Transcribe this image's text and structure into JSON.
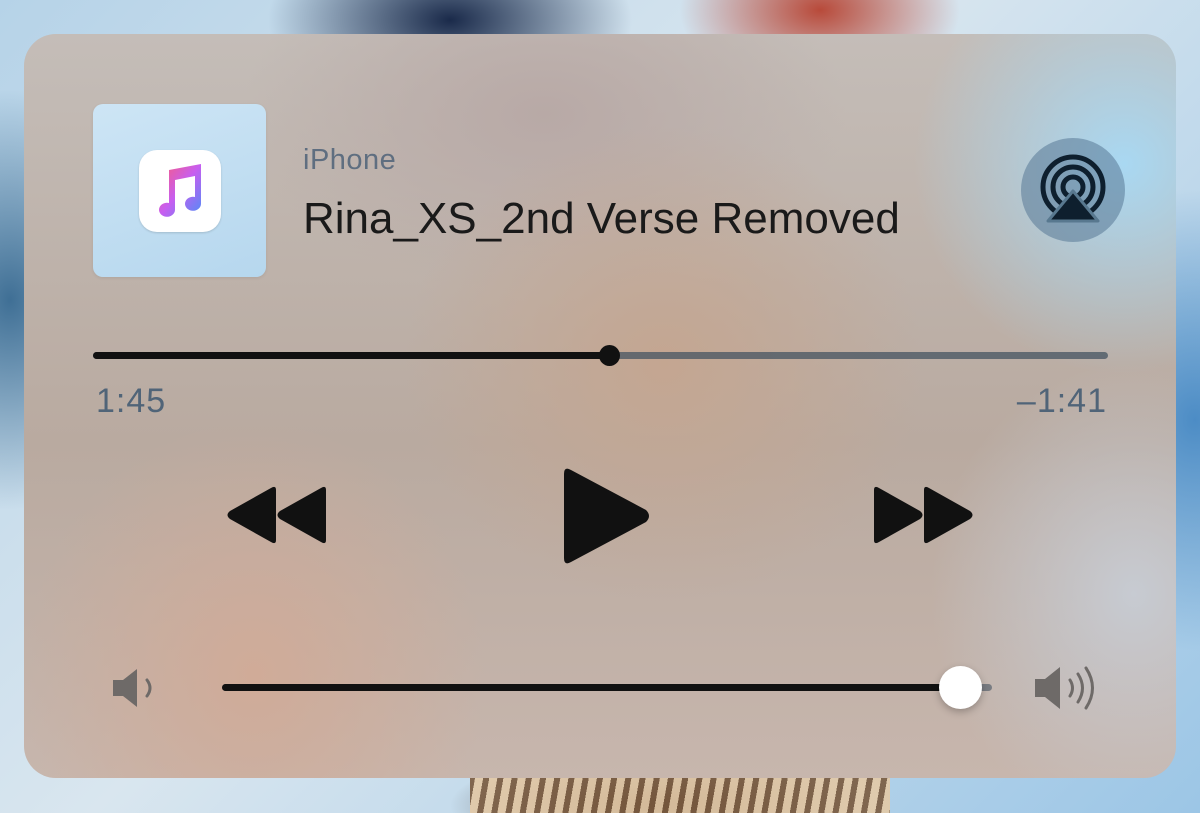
{
  "now_playing": {
    "source": "iPhone",
    "title": "Rina_XS_2nd Verse Removed",
    "artwork_icon": "apple-music-icon",
    "output_icon": "airplay-audio-icon"
  },
  "progress": {
    "elapsed": "1:45",
    "remaining": "–1:41",
    "fraction": 0.508
  },
  "controls": {
    "rewind_icon": "rewind-icon",
    "play_icon": "play-icon",
    "forward_icon": "fast-forward-icon"
  },
  "volume": {
    "level": 0.96,
    "low_icon": "speaker-low-icon",
    "high_icon": "speaker-high-icon"
  },
  "colors": {
    "text_primary": "#1a1a1a",
    "text_secondary": "#506478",
    "slider_fill": "#111111",
    "knob": "#ffffff"
  }
}
